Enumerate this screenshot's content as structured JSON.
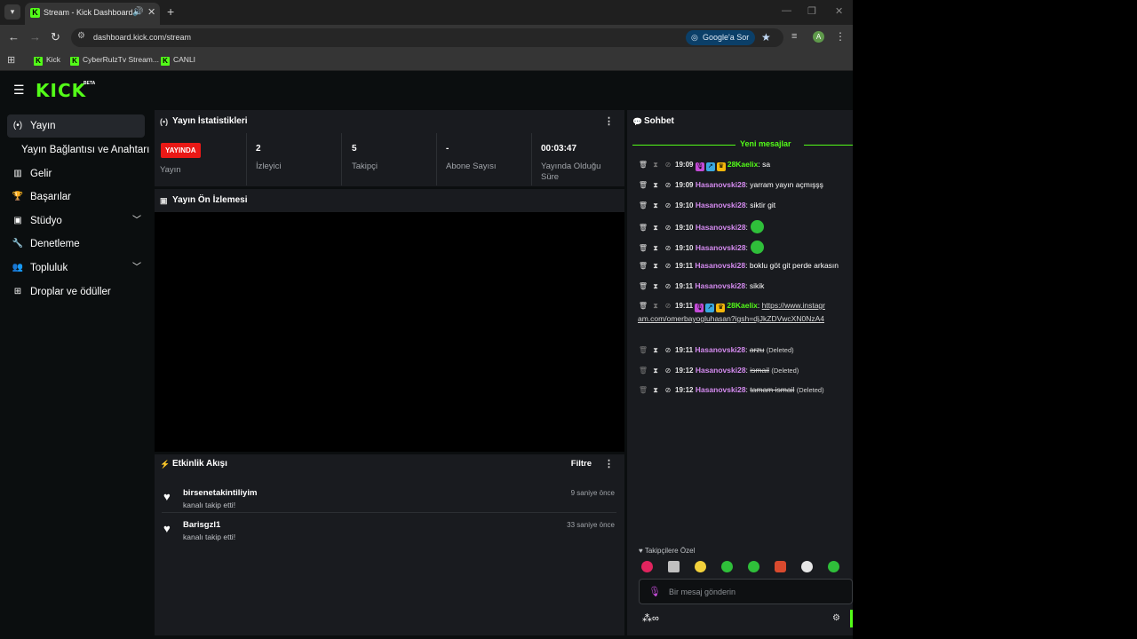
{
  "browser": {
    "tab_title": "Stream - Kick Dashboard",
    "url": "dashboard.kick.com/stream",
    "google_button": "Google'a Sor",
    "profile_initial": "A",
    "bookmarks": [
      "Kick",
      "CyberRulzTv Stream...",
      "CANLI"
    ]
  },
  "header": {
    "logo": "KICK",
    "beta": "BETA"
  },
  "sidebar": {
    "items": [
      {
        "label": "Yayın",
        "icon": "broadcast-icon"
      },
      {
        "label": "Yayın Bağlantısı ve Anahtarı",
        "icon": ""
      },
      {
        "label": "Gelir",
        "icon": "chart-icon"
      },
      {
        "label": "Başarılar",
        "icon": "trophy-icon"
      },
      {
        "label": "Stüdyo",
        "icon": "studio-icon"
      },
      {
        "label": "Denetleme",
        "icon": "wrench-icon"
      },
      {
        "label": "Topluluk",
        "icon": "people-icon"
      },
      {
        "label": "Droplar ve ödüller",
        "icon": "gift-icon"
      }
    ]
  },
  "stats": {
    "title": "Yayın İstatistikleri",
    "live_badge": "YAYINDA",
    "items": [
      {
        "value": "",
        "label": "Yayın"
      },
      {
        "value": "2",
        "label": "İzleyici"
      },
      {
        "value": "5",
        "label": "Takipçi"
      },
      {
        "value": "-",
        "label": "Abone Sayısı"
      },
      {
        "value": "00:03:47",
        "label": "Yayında Olduğu Süre"
      }
    ]
  },
  "preview": {
    "title": "Yayın Ön İzlemesi"
  },
  "activity": {
    "title": "Etkinlik Akışı",
    "filter": "Filtre",
    "events": [
      {
        "name": "birsenetakintiliyim",
        "desc": "kanalı takip etti!",
        "time": "9 saniye önce"
      },
      {
        "name": "Barisgzl1",
        "desc": "kanalı takip etti!",
        "time": "33 saniye önce"
      }
    ]
  },
  "chat": {
    "title": "Sohbet",
    "new_messages": "Yeni mesajlar",
    "messages": [
      {
        "time": "19:09",
        "user": "28Kaelix",
        "text": "sa"
      },
      {
        "time": "19:09",
        "user": "Hasanovski28",
        "text": "yarram yayın açmışşş"
      },
      {
        "time": "19:10",
        "user": "Hasanovski28",
        "text": "siktir git"
      },
      {
        "time": "19:10",
        "user": "Hasanovski28",
        "text": ""
      },
      {
        "time": "19:10",
        "user": "Hasanovski28",
        "text": ""
      },
      {
        "time": "19:11",
        "user": "Hasanovski28",
        "text": "boklu göt git perde arkasın"
      },
      {
        "time": "19:11",
        "user": "Hasanovski28",
        "text": "sikik"
      },
      {
        "time": "19:11",
        "user": "28Kaelix",
        "text": "https://www.instagram.com/omerbayogluhasan?igsh=djJkZDVwcXN0NzA4"
      },
      {
        "time": "19:11",
        "user": "Hasanovski28",
        "text": "arzu",
        "deleted": "(Deleted)"
      },
      {
        "time": "19:12",
        "user": "Hasanovski28",
        "text": "ismail",
        "deleted": "(Deleted)"
      },
      {
        "time": "19:12",
        "user": "Hasanovski28",
        "text": "tamam ismail",
        "deleted": "(Deleted)"
      }
    ],
    "followers_only": "Takipçilere Özel",
    "input_placeholder": "Bir mesaj gönderin"
  },
  "colors": {
    "brand": "#53fc18",
    "live": "#e91916",
    "user_purple": "#d58bf0",
    "user_green": "#53fc18"
  }
}
